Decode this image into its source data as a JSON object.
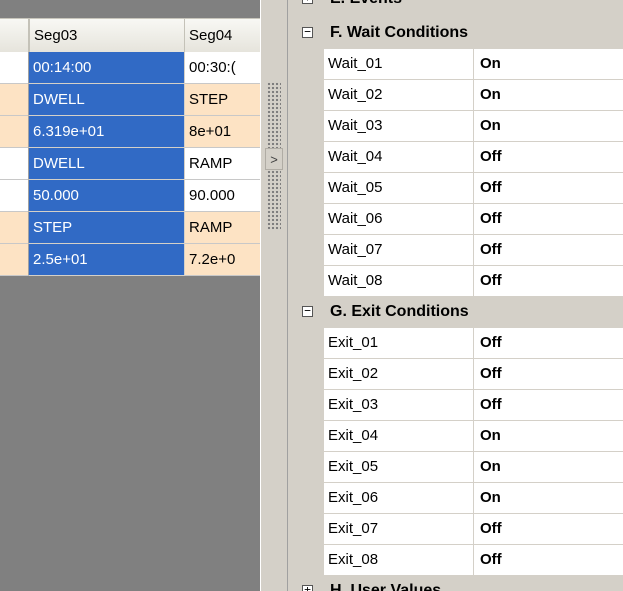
{
  "grid": {
    "columns": [
      "",
      "Seg03",
      "Seg04"
    ],
    "rows": [
      {
        "c1": "00:14:00",
        "c2": "00:30:("
      },
      {
        "c1": "DWELL",
        "c2": "STEP"
      },
      {
        "c1": "6.319e+01",
        "c2": "8e+01"
      },
      {
        "c1": "DWELL",
        "c2": "RAMP"
      },
      {
        "c1": "50.000",
        "c2": "90.000"
      },
      {
        "c1": "STEP",
        "c2": "RAMP"
      },
      {
        "c1": "2.5e+01",
        "c2": "7.2e+0"
      }
    ]
  },
  "splitter": {
    "arrow": ">"
  },
  "properties": {
    "top_category": {
      "toggle": "⊞",
      "label": "E. Events"
    },
    "wait": {
      "toggle": "⊟",
      "label": "F. Wait Conditions",
      "items": [
        {
          "name": "Wait_01",
          "value": "On"
        },
        {
          "name": "Wait_02",
          "value": "On"
        },
        {
          "name": "Wait_03",
          "value": "On"
        },
        {
          "name": "Wait_04",
          "value": "Off"
        },
        {
          "name": "Wait_05",
          "value": "Off"
        },
        {
          "name": "Wait_06",
          "value": "Off"
        },
        {
          "name": "Wait_07",
          "value": "Off"
        },
        {
          "name": "Wait_08",
          "value": "Off"
        }
      ]
    },
    "exit": {
      "toggle": "⊟",
      "label": "G. Exit Conditions",
      "items": [
        {
          "name": "Exit_01",
          "value": "Off"
        },
        {
          "name": "Exit_02",
          "value": "Off"
        },
        {
          "name": "Exit_03",
          "value": "Off"
        },
        {
          "name": "Exit_04",
          "value": "On"
        },
        {
          "name": "Exit_05",
          "value": "On"
        },
        {
          "name": "Exit_06",
          "value": "On"
        },
        {
          "name": "Exit_07",
          "value": "Off"
        },
        {
          "name": "Exit_08",
          "value": "Off"
        }
      ]
    },
    "bottom_category": {
      "label": "H. User Values"
    }
  }
}
